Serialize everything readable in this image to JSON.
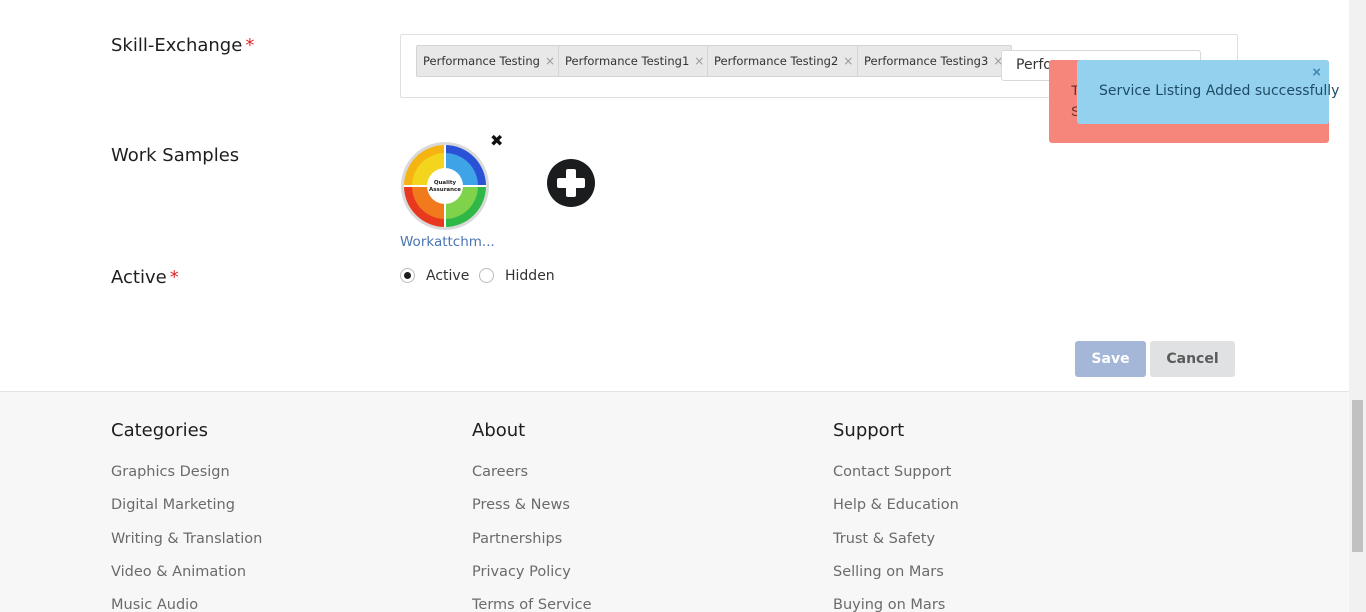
{
  "form": {
    "skill_exchange": {
      "label": "Skill-Exchange",
      "required_mark": "*",
      "tags": [
        {
          "label": "Performance Testing",
          "remove": "×"
        },
        {
          "label": "Performance Testing1",
          "remove": "×"
        },
        {
          "label": "Performance Testing2",
          "remove": "×"
        },
        {
          "label": "Performance Testing3",
          "remove": "×"
        }
      ],
      "input_value": "Perfo"
    },
    "work_samples": {
      "label": "Work Samples",
      "remove_icon": "✖",
      "items": [
        {
          "name": "Workattchm...",
          "image_text": "Quality Assurance"
        }
      ],
      "add_icon": "plus-circle-icon"
    },
    "active": {
      "label": "Active",
      "required_mark": "*",
      "options": [
        {
          "label": "Active",
          "selected": true
        },
        {
          "label": "Hidden",
          "selected": false
        }
      ]
    },
    "save_label": "Save",
    "cancel_label": "Cancel"
  },
  "footer": {
    "columns": [
      {
        "title": "Categories",
        "links": [
          "Graphics Design",
          "Digital Marketing",
          "Writing & Translation",
          "Video & Animation",
          "Music Audio"
        ]
      },
      {
        "title": "About",
        "links": [
          "Careers",
          "Press & News",
          "Partnerships",
          "Privacy Policy",
          "Terms of Service"
        ]
      },
      {
        "title": "Support",
        "links": [
          "Contact Support",
          "Help & Education",
          "Trust & Safety",
          "Selling on Mars",
          "Buying on Mars"
        ]
      }
    ]
  },
  "toasts": {
    "error": {
      "line1": "T",
      "line2": "S",
      "color": "#f6867c"
    },
    "success": {
      "message": "Service Listing Added successfully",
      "close": "×",
      "color": "#93d1ee"
    }
  },
  "colors": {
    "accent": "#a5b7d8",
    "link": "#4a74b3",
    "required": "#db2828"
  }
}
